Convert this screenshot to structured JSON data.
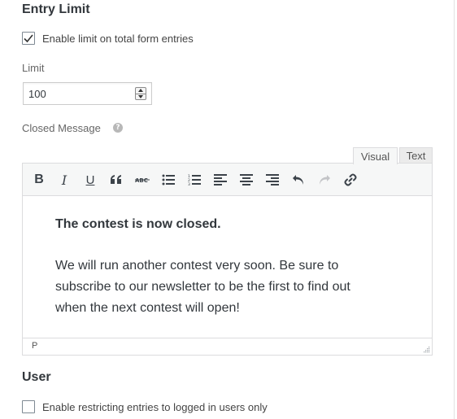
{
  "entry_limit": {
    "title": "Entry Limit",
    "enable_checkbox": {
      "label": "Enable limit on total form entries",
      "checked": true
    },
    "limit_label": "Limit",
    "limit_value": "100"
  },
  "closed_message": {
    "label": "Closed Message",
    "help_icon": "question-circle-icon",
    "tabs": {
      "visual": "Visual",
      "text": "Text",
      "active": "Visual"
    },
    "toolbar": [
      "bold-icon",
      "italic-icon",
      "underline-icon",
      "blockquote-icon",
      "strikethrough-icon",
      "bullet-list-icon",
      "numbered-list-icon",
      "align-left-icon",
      "align-center-icon",
      "align-right-icon",
      "undo-icon",
      "redo-icon",
      "link-icon"
    ],
    "content": {
      "heading": "The contest is now closed.",
      "paragraph_lines": [
        "We will run another contest very soon. Be sure to",
        "subscribe to our newsletter to be the first to find out",
        "when the next contest will open!"
      ]
    },
    "status_path": "P"
  },
  "user": {
    "title": "User",
    "restrict_checkbox": {
      "label": "Enable restricting entries to logged in users only",
      "checked": false
    }
  }
}
